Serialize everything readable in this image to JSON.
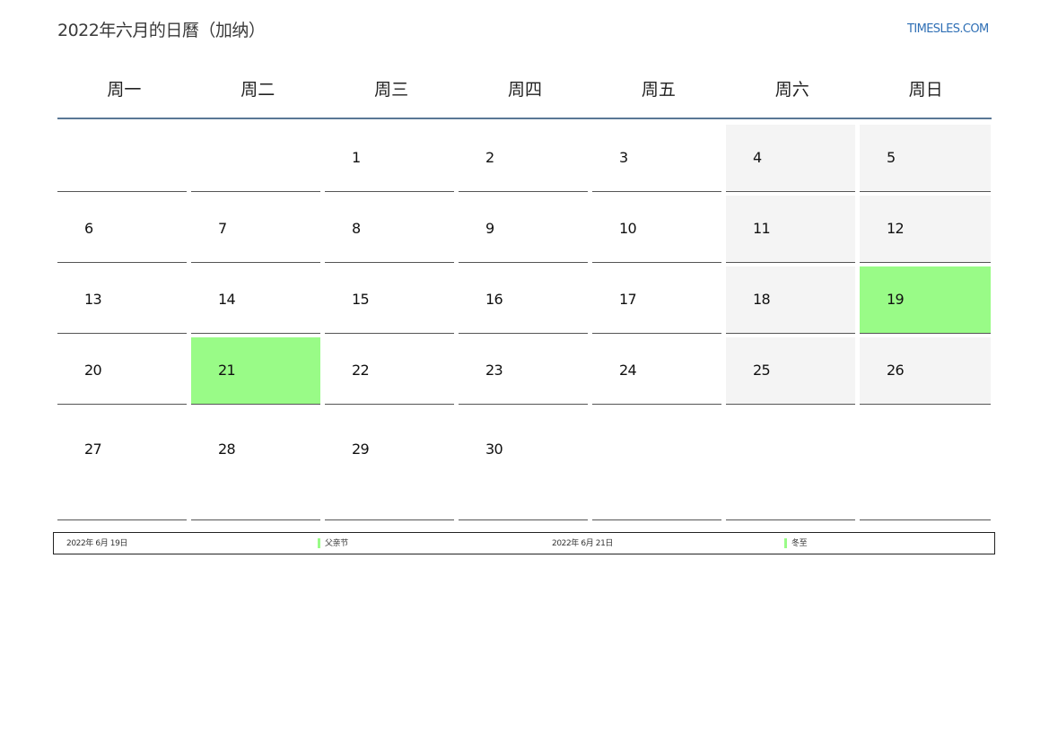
{
  "header": {
    "title": "2022年六月的日曆（加纳）",
    "site": "TIMESLES.COM"
  },
  "weekdays": [
    "周一",
    "周二",
    "周三",
    "周四",
    "周五",
    "周六",
    "周日"
  ],
  "weeks": [
    [
      "",
      "",
      "1",
      "2",
      "3",
      "4",
      "5"
    ],
    [
      "6",
      "7",
      "8",
      "9",
      "10",
      "11",
      "12"
    ],
    [
      "13",
      "14",
      "15",
      "16",
      "17",
      "18",
      "19"
    ],
    [
      "20",
      "21",
      "22",
      "23",
      "24",
      "25",
      "26"
    ],
    [
      "27",
      "28",
      "29",
      "30",
      "",
      "",
      ""
    ]
  ],
  "holidays": [
    {
      "date": "2022年 6月 19日",
      "name": "父亲节"
    },
    {
      "date": "2022年 6月 21日",
      "name": "冬至"
    }
  ],
  "colors": {
    "holiday": "#99fb87",
    "weekend": "#f4f4f4",
    "accent_line": "#5a7796",
    "link": "#2f6fb5"
  }
}
